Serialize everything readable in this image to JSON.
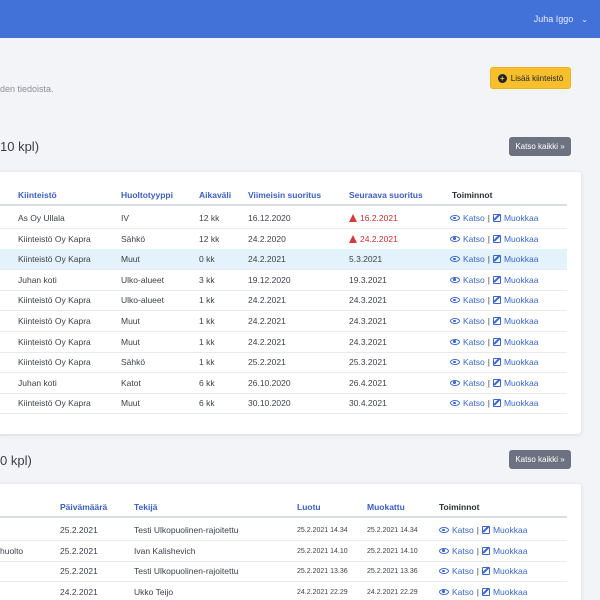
{
  "header": {
    "user_name": "Juha Iggo"
  },
  "page": {
    "subtitle": "den tiedoista.",
    "add_button_label": "Lisää kiinteistö"
  },
  "upcoming": {
    "title": "10 kpl)",
    "view_all_label": "Katso kaikki »",
    "columns": {
      "property": "Kiinteistö",
      "type": "Huoltotyyppi",
      "interval": "Aikaväli",
      "last": "Viimeisin suoritus",
      "next": "Seuraava suoritus",
      "actions": "Toiminnot"
    },
    "rows": [
      {
        "property": "As Oy Ullala",
        "type": "IV",
        "interval": "12 kk",
        "last": "16.12.2020",
        "next": "16.2.2021",
        "overdue": true
      },
      {
        "property": "Kiinteistö Oy Kapra",
        "type": "Sähkö",
        "interval": "12 kk",
        "last": "24.2.2020",
        "next": "24.2.2021",
        "overdue": true
      },
      {
        "property": "Kiinteistö Oy Kapra",
        "type": "Muut",
        "interval": "0 kk",
        "last": "24.2.2021",
        "next": "5.3.2021",
        "overdue": false
      },
      {
        "property": "Juhan koti",
        "type": "Ulko-alueet",
        "interval": "3 kk",
        "last": "19.12.2020",
        "next": "19.3.2021",
        "overdue": false
      },
      {
        "property": "Kiinteistö Oy Kapra",
        "type": "Ulko-alueet",
        "interval": "1 kk",
        "last": "24.2.2021",
        "next": "24.3.2021",
        "overdue": false
      },
      {
        "property": "Kiinteistö Oy Kapra",
        "type": "Muut",
        "interval": "1 kk",
        "last": "24.2.2021",
        "next": "24.3.2021",
        "overdue": false
      },
      {
        "property": "Kiinteistö Oy Kapra",
        "type": "Muut",
        "interval": "1 kk",
        "last": "24.2.2021",
        "next": "24.3.2021",
        "overdue": false
      },
      {
        "property": "Kiinteistö Oy Kapra",
        "type": "Sähkö",
        "interval": "1 kk",
        "last": "25.2.2021",
        "next": "25.3.2021",
        "overdue": false
      },
      {
        "property": "Juhan koti",
        "type": "Katot",
        "interval": "6 kk",
        "last": "26.10.2020",
        "next": "26.4.2021",
        "overdue": false
      },
      {
        "property": "Kiinteistö Oy Kapra",
        "type": "Muut",
        "interval": "6 kk",
        "last": "30.10.2020",
        "next": "30.4.2021",
        "overdue": false
      }
    ],
    "highlighted_row": 2
  },
  "recent": {
    "title": "0 kpl)",
    "view_all_label": "Katso kaikki »",
    "columns": {
      "date": "Päivämäärä",
      "author": "Tekijä",
      "created": "Luotu",
      "modified": "Muokattu",
      "actions": "Toiminnot"
    },
    "rows": [
      {
        "prefix": "",
        "date": "25.2.2021",
        "author": "Testi Ulkopuolinen-rajoitettu",
        "created": "25.2.2021 14.34",
        "modified": "25.2.2021 14.34"
      },
      {
        "prefix": "huolto",
        "date": "25.2.2021",
        "author": "Ivan Kalishevich",
        "created": "25.2.2021 14.10",
        "modified": "25.2.2021 14.10"
      },
      {
        "prefix": "",
        "date": "25.2.2021",
        "author": "Testi Ulkopuolinen-rajoitettu",
        "created": "25.2.2021 13.36",
        "modified": "25.2.2021 13.36"
      },
      {
        "prefix": "",
        "date": "24.2.2021",
        "author": "Ukko Teijo",
        "created": "24.2.2021 22.29",
        "modified": "24.2.2021 22.29"
      }
    ]
  },
  "actions": {
    "view": "Katso",
    "separator": "|",
    "edit": "Muokkaa"
  }
}
